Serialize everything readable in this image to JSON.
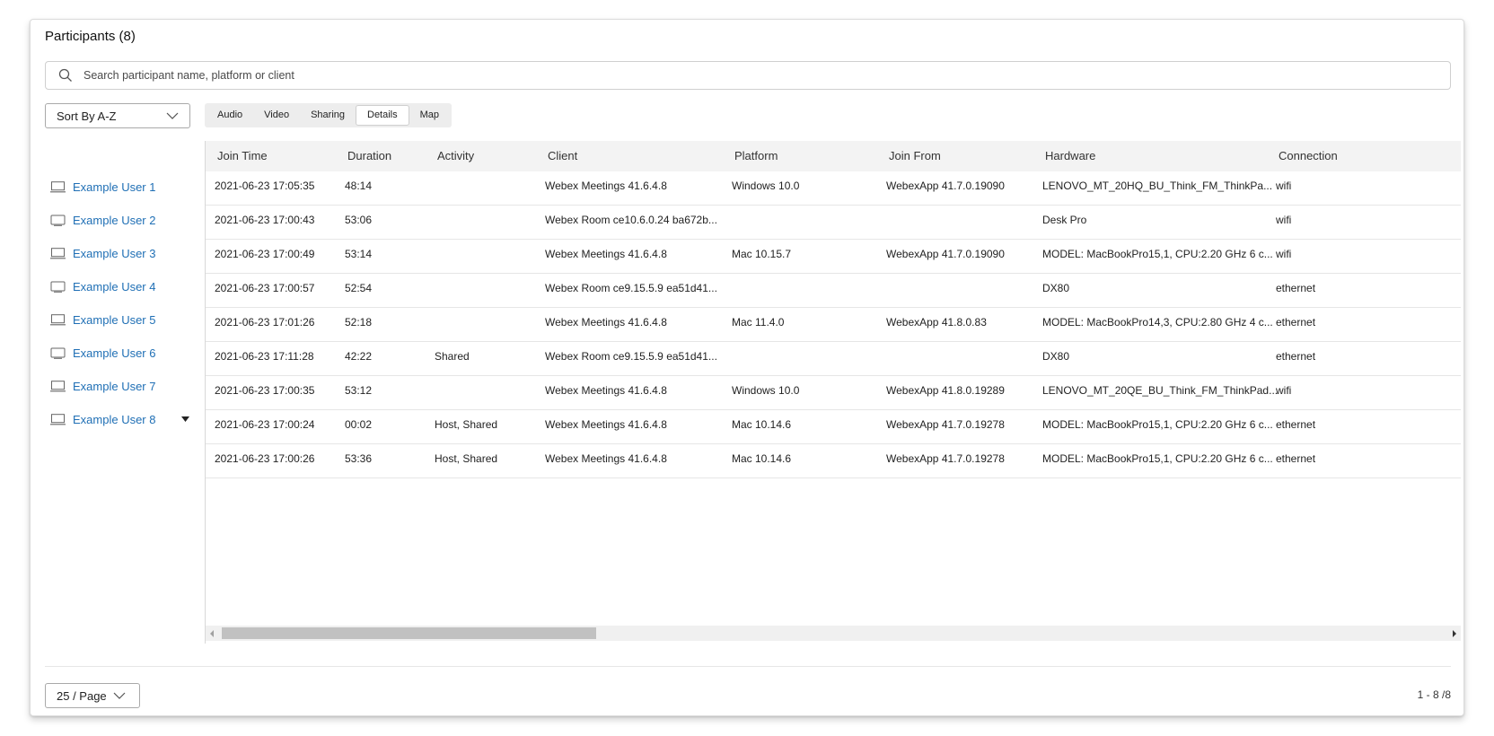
{
  "header": {
    "title": "Participants (8)"
  },
  "search": {
    "placeholder": "Search participant name, platform or client"
  },
  "sort": {
    "selected": "Sort By A-Z"
  },
  "tabs": [
    {
      "label": "Audio"
    },
    {
      "label": "Video"
    },
    {
      "label": "Sharing"
    },
    {
      "label": "Details",
      "active": true
    },
    {
      "label": "Map"
    }
  ],
  "participants": [
    {
      "name": "Example User 1",
      "icon": "laptop-icon"
    },
    {
      "name": "Example User 2",
      "icon": "room-device-icon"
    },
    {
      "name": "Example User 3",
      "icon": "laptop-icon"
    },
    {
      "name": "Example User 4",
      "icon": "room-device-icon"
    },
    {
      "name": "Example User 5",
      "icon": "laptop-icon"
    },
    {
      "name": "Example User 6",
      "icon": "room-device-icon"
    },
    {
      "name": "Example User 7",
      "icon": "laptop-icon"
    },
    {
      "name": "Example User 8",
      "icon": "laptop-icon",
      "expanded": true
    }
  ],
  "table": {
    "columns": [
      "Join Time",
      "Duration",
      "Activity",
      "Client",
      "Platform",
      "Join From",
      "Hardware",
      "Connection"
    ],
    "rows": [
      [
        "2021-06-23 17:05:35",
        "48:14",
        "",
        "Webex Meetings 41.6.4.8",
        "Windows 10.0",
        "WebexApp 41.7.0.19090",
        "LENOVO_MT_20HQ_BU_Think_FM_ThinkPa...",
        "wifi"
      ],
      [
        "2021-06-23 17:00:43",
        "53:06",
        "",
        "Webex Room ce10.6.0.24 ba672b...",
        "",
        "",
        "Desk Pro",
        "wifi"
      ],
      [
        "2021-06-23 17:00:49",
        "53:14",
        "",
        "Webex Meetings 41.6.4.8",
        "Mac 10.15.7",
        "WebexApp 41.7.0.19090",
        "MODEL: MacBookPro15,1, CPU:2.20 GHz 6 c...",
        "wifi"
      ],
      [
        "2021-06-23 17:00:57",
        "52:54",
        "",
        "Webex Room ce9.15.5.9 ea51d41...",
        "",
        "",
        "DX80",
        "ethernet"
      ],
      [
        "2021-06-23 17:01:26",
        "52:18",
        "",
        "Webex Meetings 41.6.4.8",
        "Mac 11.4.0",
        "WebexApp 41.8.0.83",
        "MODEL: MacBookPro14,3, CPU:2.80 GHz 4 c...",
        "ethernet"
      ],
      [
        "2021-06-23 17:11:28",
        "42:22",
        "Shared",
        "Webex Room ce9.15.5.9 ea51d41...",
        "",
        "",
        "DX80",
        "ethernet"
      ],
      [
        "2021-06-23 17:00:35",
        "53:12",
        "",
        "Webex Meetings 41.6.4.8",
        "Windows 10.0",
        "WebexApp 41.8.0.19289",
        "LENOVO_MT_20QE_BU_Think_FM_ThinkPad...",
        "wifi"
      ],
      [
        "2021-06-23 17:00:24",
        "00:02",
        "Host, Shared",
        "Webex Meetings 41.6.4.8",
        "Mac 10.14.6",
        "WebexApp 41.7.0.19278",
        "MODEL: MacBookPro15,1, CPU:2.20 GHz 6 c...",
        "ethernet"
      ],
      [
        "2021-06-23 17:00:26",
        "53:36",
        "Host, Shared",
        "Webex Meetings 41.6.4.8",
        "Mac 10.14.6",
        "WebexApp 41.7.0.19278",
        "MODEL: MacBookPro15,1, CPU:2.20 GHz 6 c...",
        "ethernet"
      ]
    ]
  },
  "footer": {
    "per_page": "25 / Page",
    "page_info": "1 - 8 /8"
  },
  "colors": {
    "link": "#1f6fb5",
    "tab_bg": "#ededed",
    "header_bg": "#f3f3f3"
  }
}
